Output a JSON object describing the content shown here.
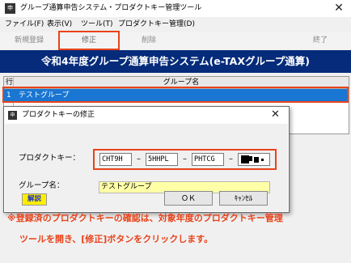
{
  "window": {
    "icon_text": "申",
    "title": "グループ通算申告システム・プロダクトキー管理ツール",
    "close_glyph": "✕"
  },
  "menu": [
    "ファイル(F)",
    "表示(V)",
    "ツール(T)",
    "プロダクトキー管理(D)"
  ],
  "toolbar": {
    "new": "新規登録",
    "edit": "修正",
    "delete": "削除",
    "exit": "終了"
  },
  "banner": "令和4年度グループ通算申告システム(e-TAXグループ通算)",
  "grid": {
    "col_row": "行",
    "col_name": "グループ名",
    "rows": [
      {
        "no": "1",
        "name": "テストグループ"
      }
    ]
  },
  "dialog": {
    "icon_text": "申",
    "title": "プロダクトキーの修正",
    "close_glyph": "✕",
    "product_key_label": "プロダクトキー：",
    "key_parts": [
      "CHT9H",
      "5HHPL",
      "PHTCG"
    ],
    "dash": "–",
    "group_name_label": "グループ名：",
    "group_name_value": "テストグループ",
    "help_button": "解説",
    "ok_button": "ＯＫ",
    "cancel_button": "ｷｬﾝｾﾙ"
  },
  "notes": [
    "※登録済のプロダクトキーの確認は、対象年度のプロダクトキー管理",
    "ツールを開き、[修正]ボタンをクリックします。"
  ],
  "colors": {
    "highlight": "#e8431b",
    "banner": "#052b7a",
    "selected_row": "#1976d2",
    "group_field": "#ffffa8",
    "help_button": "#ffee00"
  }
}
